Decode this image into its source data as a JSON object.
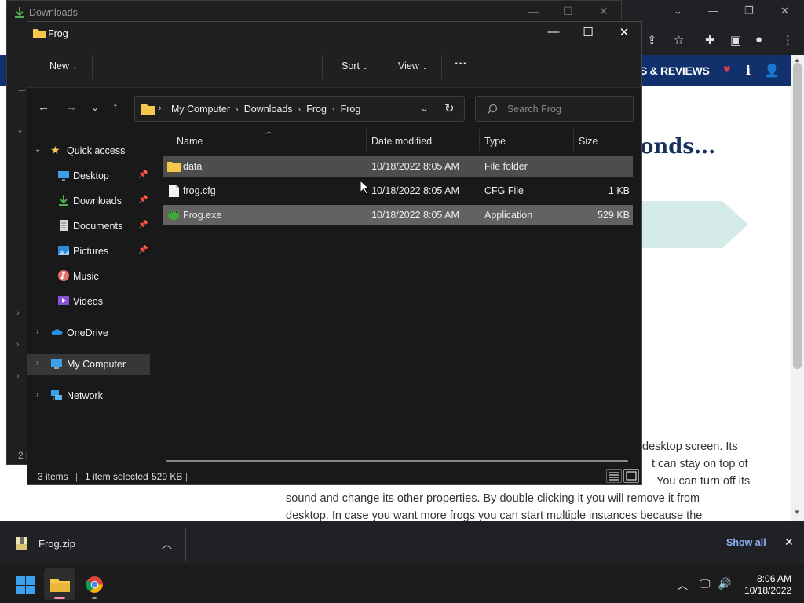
{
  "browser": {
    "nav_text": "S & REVIEWS",
    "heading": "onds...",
    "article_lines": [
      "desktop screen. Its",
      "t can stay on top of",
      "You can turn off its",
      "sound and change its other properties. By double clicking it you will remove it from",
      "desktop. In case you want more frogs you can start multiple instances because the"
    ]
  },
  "background_window": {
    "title": "Downloads",
    "status_text": "2 i"
  },
  "explorer": {
    "title": "Frog",
    "toolbar": {
      "new_label": "New",
      "sort_label": "Sort",
      "view_label": "View",
      "more_label": "···"
    },
    "breadcrumb": [
      "My Computer",
      "Downloads",
      "Frog",
      "Frog"
    ],
    "search_placeholder": "Search Frog",
    "sidebar": {
      "quick_access": "Quick access",
      "items": [
        {
          "label": "Desktop",
          "pinned": true
        },
        {
          "label": "Downloads",
          "pinned": true
        },
        {
          "label": "Documents",
          "pinned": true
        },
        {
          "label": "Pictures",
          "pinned": true
        },
        {
          "label": "Music",
          "pinned": false
        },
        {
          "label": "Videos",
          "pinned": false
        }
      ],
      "onedrive": "OneDrive",
      "my_computer": "My Computer",
      "network": "Network"
    },
    "columns": {
      "name": "Name",
      "date": "Date modified",
      "type": "Type",
      "size": "Size"
    },
    "files": [
      {
        "name": "data",
        "date": "10/18/2022 8:05 AM",
        "type": "File folder",
        "size": "",
        "icon": "folder-icon"
      },
      {
        "name": "frog.cfg",
        "date": "10/18/2022 8:05 AM",
        "type": "CFG File",
        "size": "1 KB",
        "icon": "file-icon"
      },
      {
        "name": "Frog.exe",
        "date": "10/18/2022 8:05 AM",
        "type": "Application",
        "size": "529 KB",
        "icon": "frog-app-icon"
      }
    ],
    "status": {
      "item_count": "3 items",
      "selection": "1 item selected",
      "selection_size": "529 KB"
    }
  },
  "download_bar": {
    "file_name": "Frog.zip",
    "show_all": "Show all"
  },
  "taskbar": {
    "time": "8:06 AM",
    "date": "10/18/2022"
  },
  "colors": {
    "explorer_bg": "#191919",
    "row_selected": "#626262",
    "row_hover": "#4d4d4d",
    "folder_yellow": "#f5c74a",
    "site_nav_blue": "#10316b",
    "link_blue": "#8ab4f8"
  }
}
